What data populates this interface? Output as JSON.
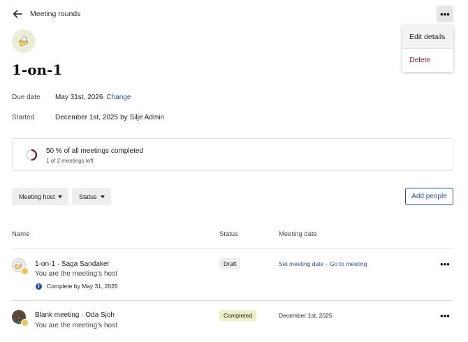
{
  "header": {
    "back_icon": "arrow-left-icon",
    "breadcrumb": "Meeting rounds",
    "more_icon": "more-horizontal-icon"
  },
  "menu": {
    "edit_label": "Edit details",
    "delete_label": "Delete"
  },
  "round": {
    "icon": "paper-envelope-icon",
    "title": "1-on-1",
    "due_label": "Due date",
    "due_value": "May 31st, 2026",
    "change_label": "Change",
    "started_label": "Started",
    "started_value": "December 1st, 2025",
    "started_by_prefix": "by",
    "started_by": "Silje Admin"
  },
  "progress": {
    "fraction": 0.5,
    "main": "50 % of all meetings completed",
    "sub": "1 of 2 meetings left"
  },
  "filters": {
    "host_label": "Meeting host",
    "status_label": "Status",
    "add_people_label": "Add people"
  },
  "table": {
    "headers": {
      "name": "Name",
      "status": "Status",
      "date": "Meeting date"
    },
    "rows": [
      {
        "title": "1-on-1 · Saga Sandaker",
        "subtitle": "You are the meeting’s host",
        "note": "Complete by May 31, 2026",
        "status": "Draft",
        "date_link_1": "Set meeting date",
        "separator": "·",
        "date_link_2": "Go to meeting"
      },
      {
        "title": "Blank meeting · Oda Sjoh",
        "subtitle": "You are the meeting’s host",
        "status": "Completed",
        "date": "December 1st, 2025"
      }
    ]
  },
  "colors": {
    "accent": "#2b4f93",
    "danger": "#8a1f3a",
    "progress_ring": "#6b1f3a",
    "completed_badge": "#eef0c9"
  }
}
